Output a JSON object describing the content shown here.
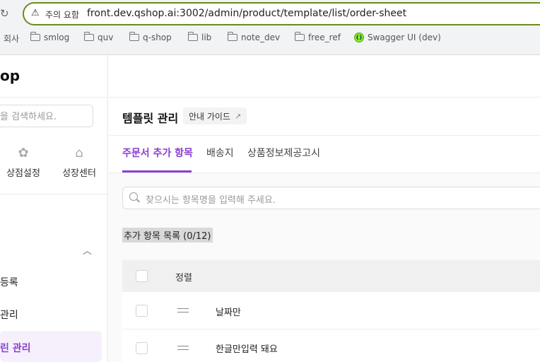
{
  "browser": {
    "reload_icon": "reload-icon",
    "security_label": "주의 요함",
    "url": "front.dev.qshop.ai:3002/admin/product/template/list/order-sheet",
    "bookmarks": [
      "회사",
      "smlog",
      "quv",
      "q-shop",
      "lib",
      "note_dev",
      "free_ref",
      "Swagger UI (dev)"
    ]
  },
  "sidebar": {
    "logo": "op",
    "search_placeholder": "을 검색하세요.",
    "quick": [
      {
        "label": "상점설정",
        "icon": "gear-icon"
      },
      {
        "label": "성장센터",
        "icon": "growth-icon"
      }
    ],
    "nav": [
      "등록",
      "관리",
      "린 관리"
    ]
  },
  "main": {
    "title": "템플릿 관리",
    "guide_button": "안내 가이드",
    "tabs": [
      "주문서 추가 항목",
      "배송지",
      "상품정보제공고시"
    ],
    "search_placeholder": "찾으시는 항목명을 입력해 주세요.",
    "list_count": "추가 항목 목록 (0/12)",
    "table": {
      "header_sort": "정렬",
      "rows": [
        {
          "name": "날짜만"
        },
        {
          "name": "한글만입력 돼요"
        }
      ]
    }
  },
  "colors": {
    "accent": "#8a3fd1",
    "urlbar_border": "#6b8c1a"
  }
}
